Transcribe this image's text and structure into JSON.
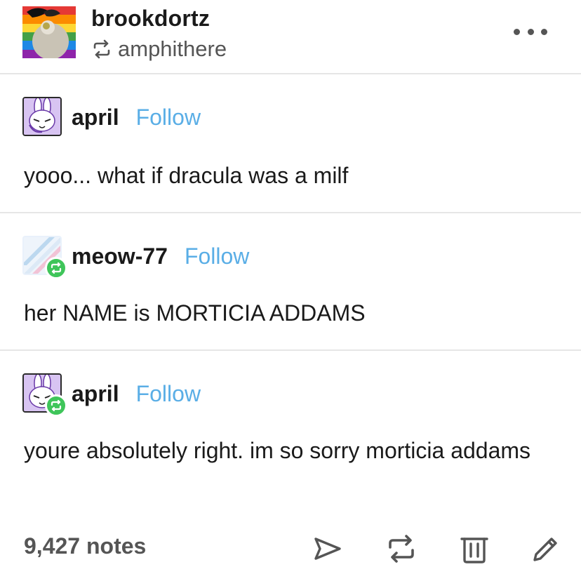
{
  "header": {
    "username": "brookdortz",
    "reblogged_from": "amphithere",
    "more_icon": "more-dots-icon"
  },
  "posts": [
    {
      "username": "april",
      "follow_label": "Follow",
      "text": "yooo... what if dracula was a milf",
      "reblog_badge": false
    },
    {
      "username": "meow-77",
      "follow_label": "Follow",
      "text": "her NAME is MORTICIA ADDAMS",
      "reblog_badge": true
    },
    {
      "username": "april",
      "follow_label": "Follow",
      "text": "youre absolutely right. im so sorry morticia addams",
      "reblog_badge": true
    }
  ],
  "footer": {
    "notes": "9,427 notes",
    "actions": [
      "share-icon",
      "reblog-icon",
      "delete-icon",
      "edit-icon"
    ]
  },
  "colors": {
    "follow": "#5aaee6",
    "reblog_badge": "#3fc55a",
    "text": "#1a1a1a",
    "muted": "#555555",
    "divider": "#e6e6e6"
  }
}
